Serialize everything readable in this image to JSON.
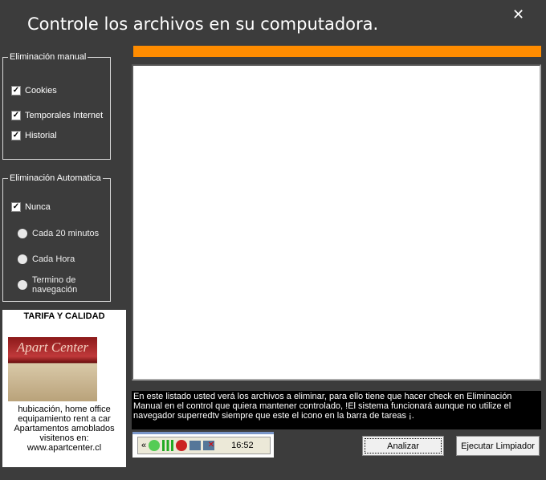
{
  "window": {
    "title": "Controle los archivos en su computadora.",
    "close": "✕"
  },
  "manual": {
    "legend": "Eliminación manual",
    "items": [
      {
        "label": "Cookies",
        "checked": true
      },
      {
        "label": "Temporales Internet",
        "checked": true
      },
      {
        "label": "Historial",
        "checked": true
      }
    ]
  },
  "auto": {
    "legend": "Eliminación Automatica",
    "nunca": "Nunca",
    "options": [
      "Cada 20 minutos",
      "Cada Hora",
      "Termino de navegación"
    ]
  },
  "ad": {
    "heading": "TARIFA Y CALIDAD",
    "logo": "Apart Center",
    "lines": [
      "hubicación, home office",
      "equipamiento rent a car",
      "Apartamentos amoblados",
      "visitenos en:",
      "www.apartcenter.cl"
    ]
  },
  "info": "En este listado usted verá los archivos a eliminar, para ello tiene que hacer check en Eliminación Manual en el control que quiera mantener controlado, !El sistema funcionará aunque no utilize el navegador superredtv siempre que este el icono en la barra de tareas ¡.",
  "tray": {
    "chevron": "«",
    "time": "16:52"
  },
  "buttons": {
    "analizar": "Analizar",
    "ejecutar": "Ejecutar Limpiador"
  },
  "colors": {
    "progress": "#ff8c00",
    "bg": "#3c3c3c"
  }
}
